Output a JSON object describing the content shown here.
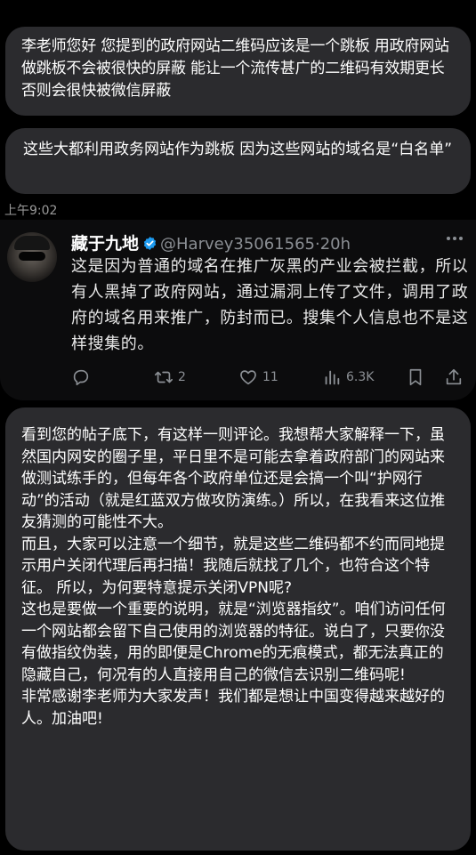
{
  "messages": {
    "first": "李老师您好 您提到的政府网站二维码应该是一个跳板 用政府网站做跳板不会被很快的屏蔽 能让一个流传甚广的二维码有效期更长 否则会很快被微信屏蔽",
    "second": "这些大都利用政务网站作为跳板 因为这些网站的域名是“白名单”",
    "timestamp": "上午9:02",
    "third": [
      "看到您的帖子底下，有这样一则评论。我想帮大家解释一下，虽然国内网安的圈子里，平日里不是可能去拿着政府部门的网站来做测试练手的，但每年各个政府单位还是会搞一个叫“护网行动”的活动（就是红蓝双方做攻防演练。）所以，在我看来这位推友猜测的可能性不大。",
      "而且，大家可以注意一个细节，就是这些二维码都不约而同地提示用户关闭代理后再扫描！我随后就找了几个，也符合这个特征。 所以，为何要特意提示关闭VPN呢?",
      "这也是要做一个重要的说明，就是“浏览器指纹”。咱们访问任何一个网站都会留下自己使用的浏览器的特征。说白了，只要你没有做指纹伪装，用的即便是Chrome的无痕模式，都无法真正的隐藏自己，何况有的人直接用自己的微信去识别二维码呢!",
      "非常感谢李老师为大家发声！我们都是想让中国变得越来越好的人。加油吧!"
    ]
  },
  "tweet": {
    "author_name": "藏于九地",
    "handle": "@Harvey35061565",
    "separator": "·",
    "age": "20h",
    "text": "这是因为普通的域名在推广灰黑的产业会被拦截，所以有人黑掉了政府网站，通过漏洞上传了文件，调用了政府的域名用来推广，防封而已。搜集个人信息也不是这样搜集的。",
    "retweets": "2",
    "likes": "11",
    "views": "6.3K",
    "icons": [
      "reply-icon",
      "retweet-icon",
      "like-icon",
      "views-icon",
      "bookmark-icon",
      "share-icon",
      "verified-icon",
      "more-icon"
    ]
  },
  "colors": {
    "background": "#000000",
    "bubble": "#2b2b2e",
    "tweet_card": "#0c0c0d",
    "verified": "#1d9bf0",
    "muted": "#8b8f94"
  }
}
